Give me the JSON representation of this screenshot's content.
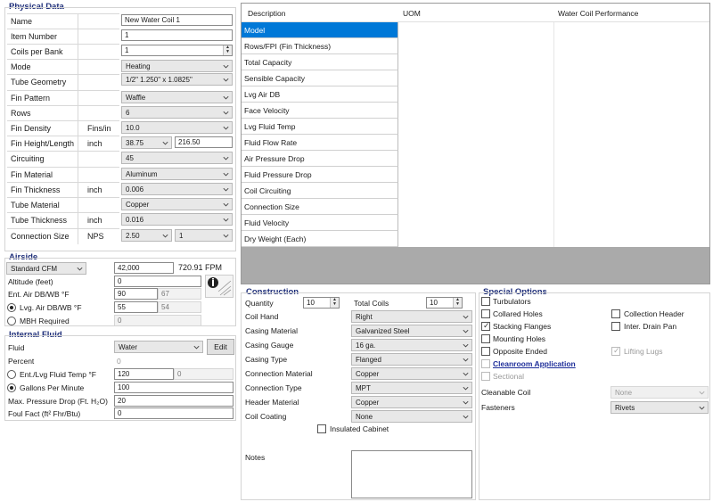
{
  "physical": {
    "title": "Physical Data",
    "rows": [
      {
        "label": "Name",
        "unit": "",
        "value": "New Water Coil 1"
      },
      {
        "label": "Item Number",
        "unit": "",
        "value": "1"
      },
      {
        "label": "Coils per Bank",
        "unit": "",
        "value": "1"
      },
      {
        "label": "Mode",
        "unit": "",
        "value": "Heating"
      },
      {
        "label": "Tube Geometry",
        "unit": "",
        "value": "1/2\" 1.250\" x 1.0825\""
      },
      {
        "label": "Fin Pattern",
        "unit": "",
        "value": "Waffle"
      },
      {
        "label": "Rows",
        "unit": "",
        "value": "6"
      },
      {
        "label": "Fin Density",
        "unit": "Fins/in",
        "value": "10.0"
      },
      {
        "label": "Fin Height/Length",
        "unit": "inch",
        "value": "38.75",
        "value2": "216.50"
      },
      {
        "label": "Circuiting",
        "unit": "",
        "value": "45"
      },
      {
        "label": "Fin Material",
        "unit": "",
        "value": "Aluminum"
      },
      {
        "label": "Fin Thickness",
        "unit": "inch",
        "value": "0.006"
      },
      {
        "label": "Tube Material",
        "unit": "",
        "value": "Copper"
      },
      {
        "label": "Tube Thickness",
        "unit": "inch",
        "value": "0.016"
      },
      {
        "label": "Connection Size",
        "unit": "NPS",
        "value": "2.50",
        "value2": "1"
      }
    ]
  },
  "airside": {
    "title": "Airside",
    "cfm_mode": "Standard CFM",
    "cfm_value": "42,000",
    "fpm": "720.91 FPM",
    "altitude_label": "Altitude (feet)",
    "altitude": "0",
    "ent_label": "Ent. Air DB/WB °F",
    "ent_db": "90",
    "ent_wb": "67",
    "lvg_label": "Lvg. Air DB/WB °F",
    "lvg_db": "55",
    "lvg_wb": "54",
    "mbh_label": "MBH Required",
    "mbh": "0"
  },
  "fluid": {
    "title": "Internal Fluid",
    "fluid_label": "Fluid",
    "fluid": "Water",
    "edit": "Edit",
    "percent_label": "Percent",
    "percent": "0",
    "temp_label": "Ent./Lvg Fluid Temp °F",
    "ent_temp": "120",
    "lvg_temp": "0",
    "gpm_label": "Gallons Per Minute",
    "gpm": "100",
    "pd_label": "Max. Pressure Drop (Ft. H₂O)",
    "pd": "20",
    "ff_label": "Foul Fact (ft² Fhr/Btu)",
    "ff": "0"
  },
  "table": {
    "headers": [
      "Description",
      "UOM",
      "Water Coil Performance"
    ],
    "rows": [
      "Model",
      "Rows/FPI (Fin Thickness)",
      "Total Capacity",
      "Sensible Capacity",
      "Lvg Air DB",
      "Face Velocity",
      "Lvg Fluid Temp",
      "Fluid Flow Rate",
      "Air Pressure Drop",
      "Fluid Pressure Drop",
      "Coil Circuiting",
      "Connection Size",
      "Fluid Velocity",
      "Dry Weight (Each)"
    ]
  },
  "construction": {
    "title": "Construction",
    "quantity_label": "Quantity",
    "quantity": "10",
    "total_coils_label": "Total Coils",
    "total_coils": "10",
    "fields": [
      {
        "label": "Coil Hand",
        "value": "Right"
      },
      {
        "label": "Casing Material",
        "value": "Galvanized Steel"
      },
      {
        "label": "Casing Gauge",
        "value": "16 ga."
      },
      {
        "label": "Casing Type",
        "value": "Flanged"
      },
      {
        "label": "Connection Material",
        "value": "Copper"
      },
      {
        "label": "Connection Type",
        "value": "MPT"
      },
      {
        "label": "Header Material",
        "value": "Copper"
      },
      {
        "label": "Coil Coating",
        "value": "None"
      }
    ],
    "insulated": "Insulated Cabinet",
    "notes": "Notes"
  },
  "special": {
    "title": "Special Options",
    "left": [
      {
        "label": "Turbulators",
        "checked": false
      },
      {
        "label": "Collared Holes",
        "checked": false
      },
      {
        "label": "Stacking Flanges",
        "checked": true
      },
      {
        "label": "Mounting Holes",
        "checked": false
      },
      {
        "label": "Opposite Ended",
        "checked": false
      }
    ],
    "cleanroom": "Cleanroom Application",
    "sectional": "Sectional",
    "right": [
      {
        "label": "Collection Header",
        "checked": false
      },
      {
        "label": "Inter. Drain Pan",
        "checked": false
      }
    ],
    "lifting": "Lifting Lugs",
    "cleanable_label": "Cleanable Coil",
    "cleanable": "None",
    "fasteners_label": "Fasteners",
    "fasteners": "Rivets"
  },
  "colors": {
    "accent": "#0078d7",
    "section_title": "#1f2f7a"
  }
}
